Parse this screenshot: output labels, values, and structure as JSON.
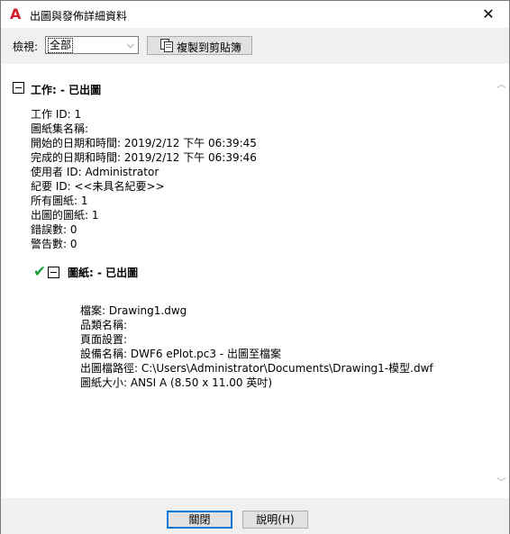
{
  "window": {
    "title": "出圖與發佈詳細資料",
    "app_icon_letter": "A"
  },
  "toolbar": {
    "view_label": "檢視:",
    "view_selected": "全部",
    "copy_label": "複製到剪貼簿"
  },
  "job": {
    "heading": "工作: - 已出圖",
    "details": [
      "工作 ID: 1",
      "圖紙集名稱:",
      "開始的日期和時間: 2019/2/12 下午 06:39:45",
      "完成的日期和時間: 2019/2/12 下午 06:39:46",
      "使用者 ID: Administrator",
      "紀要 ID: <<未具名紀要>>",
      "所有圖紙: 1",
      "出圖的圖紙: 1",
      "錯誤數: 0",
      "警告數: 0"
    ]
  },
  "sheet": {
    "heading": "圖紙: - 已出圖",
    "details": [
      "檔案: Drawing1.dwg",
      "品類名稱:",
      "頁面設置:",
      "設備名稱: DWF6 ePlot.pc3 - 出圖至檔案",
      "出圖檔路徑: C:\\Users\\Administrator\\Documents\\Drawing1-模型.dwf",
      "圖紙大小: ANSI A (8.50 x 11.00 英吋)"
    ]
  },
  "footer": {
    "close_label": "關閉",
    "help_label": "說明(H)"
  },
  "colors": {
    "accent": "#0078d7",
    "success": "#1f9d3a",
    "app_red": "#d2202f"
  }
}
